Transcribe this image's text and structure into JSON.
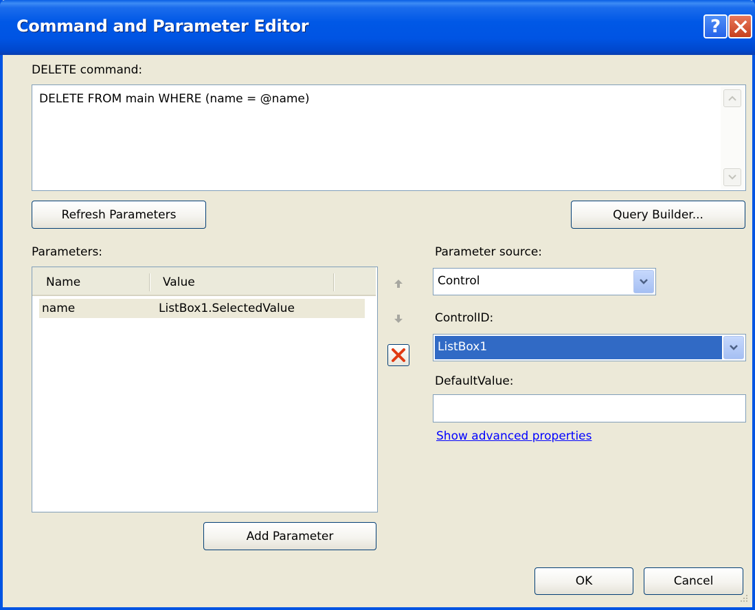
{
  "window": {
    "title": "Command and Parameter Editor",
    "help_glyph": "?",
    "help_icon": "help-icon",
    "close_icon": "close-icon",
    "titlebar_color": "#0054e3"
  },
  "command": {
    "label": "DELETE command:",
    "value": "DELETE FROM main WHERE (name = @name)"
  },
  "buttons": {
    "refresh_parameters": "Refresh Parameters",
    "query_builder": "Query Builder...",
    "add_parameter": "Add Parameter",
    "ok": "OK",
    "cancel": "Cancel"
  },
  "parameters": {
    "label": "Parameters:",
    "columns": [
      "Name",
      "Value"
    ],
    "rows": [
      {
        "name": "name",
        "value": "ListBox1.SelectedValue"
      }
    ]
  },
  "reorder": {
    "move_up_icon": "arrow-up-icon",
    "move_down_icon": "arrow-down-icon",
    "remove_icon": "delete-x-icon"
  },
  "parameter_source": {
    "label": "Parameter source:",
    "selected": "Control"
  },
  "control_id": {
    "label": "ControlID:",
    "selected": "ListBox1"
  },
  "default_value": {
    "label": "DefaultValue:",
    "value": ""
  },
  "advanced_link": "Show advanced properties",
  "colors": {
    "dialog_background": "#ece9d8",
    "selection": "#316ac5",
    "link": "#0000ff",
    "delete_x": "#e03a12"
  }
}
